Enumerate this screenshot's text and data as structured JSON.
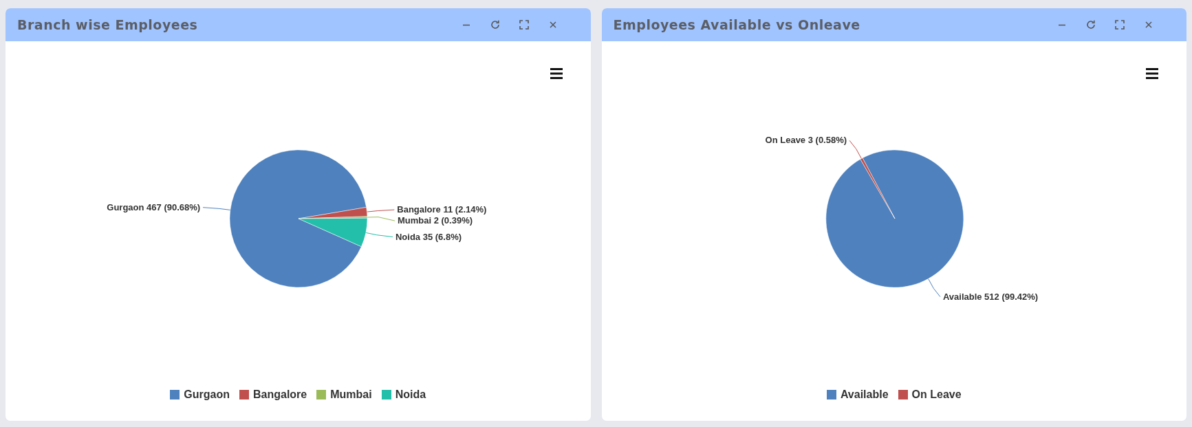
{
  "panels": [
    {
      "title": "Branch wise Employees",
      "chart_data": {
        "type": "pie",
        "categories": [
          "Gurgaon",
          "Bangalore",
          "Mumbai",
          "Noida"
        ],
        "values": [
          467,
          11,
          2,
          35
        ],
        "value_labels": [
          "Gurgaon 467 (90.68%)",
          "Bangalore 11 (2.14%)",
          "Mumbai 2 (0.39%)",
          "Noida 35 (6.8%)"
        ]
      },
      "legend": [
        {
          "color": "#4e81bd"
        },
        {
          "color": "#c0504d"
        },
        {
          "color": "#9bbb59"
        },
        {
          "color": "#23bfaa"
        }
      ]
    },
    {
      "title": "Employees Available vs Onleave",
      "chart_data": {
        "type": "pie",
        "categories": [
          "Available",
          "On Leave"
        ],
        "values": [
          512,
          3
        ],
        "value_labels": [
          "Available 512 (99.42%)",
          "On Leave 3 (0.58%)"
        ]
      },
      "legend": [
        {
          "color": "#4e81bd"
        },
        {
          "color": "#c0504d"
        }
      ]
    }
  ]
}
